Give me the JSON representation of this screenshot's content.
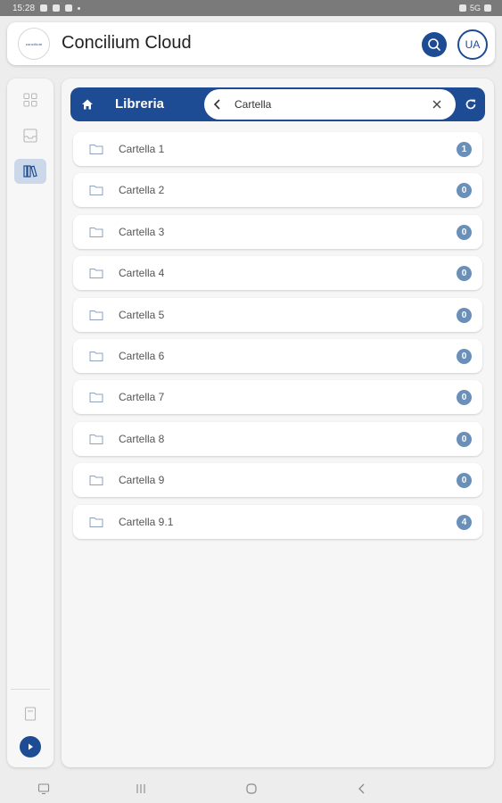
{
  "status_bar": {
    "time": "15:28",
    "right_text": "5G"
  },
  "header": {
    "logo_text": "concilium",
    "title": "Concilium Cloud",
    "avatar_initials": "UA"
  },
  "toolbar": {
    "title": "Libreria",
    "search_value": "Cartella"
  },
  "folders": [
    {
      "name": "Cartella 1",
      "count": "1"
    },
    {
      "name": "Cartella 2",
      "count": "0"
    },
    {
      "name": "Cartella 3",
      "count": "0"
    },
    {
      "name": "Cartella 4",
      "count": "0"
    },
    {
      "name": "Cartella 5",
      "count": "0"
    },
    {
      "name": "Cartella 6",
      "count": "0"
    },
    {
      "name": "Cartella 7",
      "count": "0"
    },
    {
      "name": "Cartella 8",
      "count": "0"
    },
    {
      "name": "Cartella 9",
      "count": "0"
    },
    {
      "name": "Cartella 9.1",
      "count": "4"
    }
  ],
  "colors": {
    "primary": "#1d4b94",
    "badge": "#6a8fb8",
    "rail_active": "#cbd8e9"
  },
  "icons": {
    "rail": [
      "grid-icon",
      "inbox-icon",
      "library-icon",
      "document-icon"
    ],
    "nav": [
      "keyboard-icon",
      "recents-icon",
      "home-icon",
      "back-icon"
    ]
  }
}
